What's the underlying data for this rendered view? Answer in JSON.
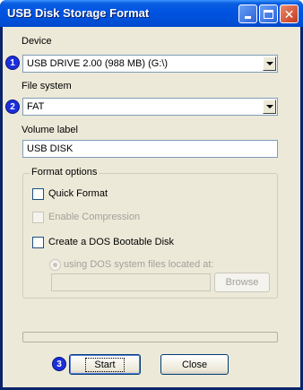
{
  "window": {
    "title": "USB Disk Storage Format"
  },
  "device": {
    "label": "Device",
    "selected": "USB DRIVE 2.00 (988 MB) (G:\\)",
    "step": "1"
  },
  "file_system": {
    "label": "File system",
    "selected": "FAT",
    "step": "2"
  },
  "volume_label": {
    "label": "Volume label",
    "value": "USB DISK"
  },
  "format_options": {
    "label": "Format options",
    "quick_format": {
      "label": "Quick Format",
      "checked": false
    },
    "enable_compression": {
      "label": "Enable Compression",
      "checked": false,
      "enabled": false
    },
    "dos_bootable": {
      "label": "Create a DOS Bootable Disk",
      "checked": false
    },
    "dos_source": {
      "label": "using DOS system files located at:",
      "value": "",
      "enabled": false
    },
    "browse_label": "Browse"
  },
  "progress": {
    "value": 0
  },
  "actions": {
    "start_label": "Start",
    "close_label": "Close",
    "step": "3"
  },
  "colors": {
    "titlebar": "#0054e3",
    "badge": "#1b2fdc",
    "face": "#ece9d8"
  }
}
